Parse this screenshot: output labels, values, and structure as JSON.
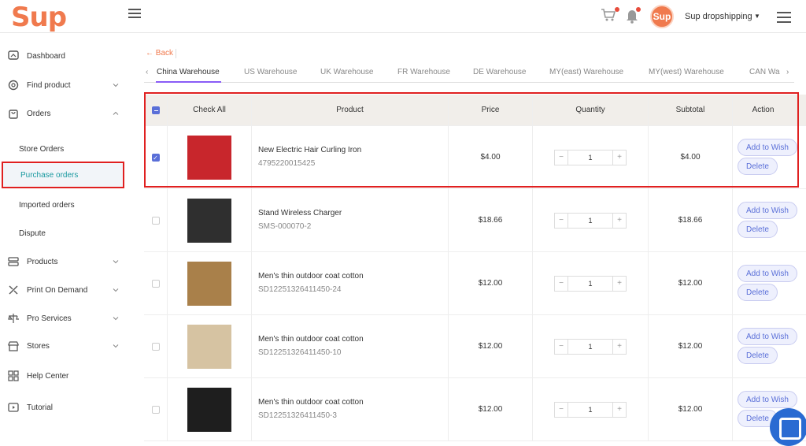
{
  "header": {
    "logo": "Sup",
    "avatar_text": "Sup",
    "user_name": "Sup dropshipping",
    "icons": [
      "collapse-icon",
      "cart-icon",
      "bell-icon",
      "hamburger-icon"
    ]
  },
  "sidebar": {
    "items": [
      {
        "label": "Dashboard",
        "icon": "dashboard-icon"
      },
      {
        "label": "Find product",
        "icon": "search-icon"
      },
      {
        "label": "Orders",
        "icon": "bag-icon"
      },
      {
        "label": "Store Orders"
      },
      {
        "label": "Purchase orders"
      },
      {
        "label": "Imported orders"
      },
      {
        "label": "Dispute"
      },
      {
        "label": "Products",
        "icon": "products-icon"
      },
      {
        "label": "Print On Demand",
        "icon": "tools-icon"
      },
      {
        "label": "Pro Services",
        "icon": "scale-icon"
      },
      {
        "label": "Stores",
        "icon": "store-icon"
      },
      {
        "label": "Help Center",
        "icon": "grid-icon"
      },
      {
        "label": "Tutorial",
        "icon": "video-icon"
      }
    ]
  },
  "main": {
    "back": "← Back",
    "tabs": [
      "China Warehouse",
      "US Warehouse",
      "UK Warehouse",
      "FR Warehouse",
      "DE Warehouse",
      "MY(east) Warehouse",
      "MY(west) Warehouse",
      "CAN Wa"
    ],
    "columns": {
      "check_all": "Check All",
      "product": "Product",
      "price": "Price",
      "quantity": "Quantity",
      "subtotal": "Subtotal",
      "action": "Action"
    },
    "rows": [
      {
        "name": "New Electric Hair Curling Iron",
        "sku": "4795220015425",
        "price": "$4.00",
        "qty": "1",
        "subtotal": "$4.00",
        "checked": true,
        "thumb_color": "#c8262c"
      },
      {
        "name": "Stand Wireless Charger",
        "sku": "SMS-000070-2",
        "price": "$18.66",
        "qty": "1",
        "subtotal": "$18.66",
        "checked": false,
        "thumb_color": "#2f2f2f"
      },
      {
        "name": "Men's thin outdoor coat cotton",
        "sku": "SD12251326411450-24",
        "price": "$12.00",
        "qty": "1",
        "subtotal": "$12.00",
        "checked": false,
        "thumb_color": "#a9804a"
      },
      {
        "name": "Men's thin outdoor coat cotton",
        "sku": "SD12251326411450-10",
        "price": "$12.00",
        "qty": "1",
        "subtotal": "$12.00",
        "checked": false,
        "thumb_color": "#d6c3a2"
      },
      {
        "name": "Men's thin outdoor coat cotton",
        "sku": "SD12251326411450-3",
        "price": "$12.00",
        "qty": "1",
        "subtotal": "$12.00",
        "checked": false,
        "thumb_color": "#1e1e1e"
      }
    ],
    "buttons": {
      "add_wish": "Add to Wish",
      "delete": "Delete"
    }
  },
  "colors": {
    "brand": "#f07a4e",
    "accent": "#5a6fd8",
    "active_teal": "#1a9aa0",
    "highlight": "#e02020"
  }
}
